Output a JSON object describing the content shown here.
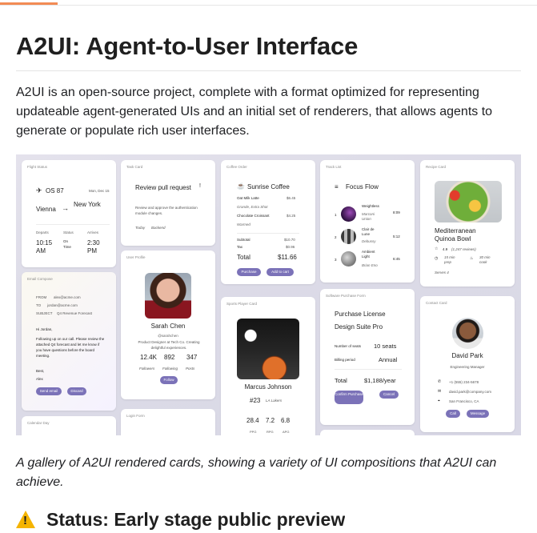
{
  "page": {
    "title": "A2UI: Agent-to-User Interface",
    "intro": "A2UI is an open-source project, complete with a format optimized for representing updateable agent-generated UIs and an initial set of renderers, that allows agents to generate or populate rich user interfaces.",
    "caption": "A gallery of A2UI rendered cards, showing a variety of UI compositions that A2UI can achieve.",
    "status_heading": "Status: Early stage public preview",
    "colors": {
      "accent": "#f28b54",
      "button": "#7b72b8",
      "warning": "#f5b400"
    }
  },
  "gallery": {
    "flight": {
      "title": "Flight Status",
      "flight_no": "OS 87",
      "date": "Mon, Dec 15",
      "from": "Vienna",
      "arrow": "→",
      "to": "New York",
      "departs_label": "Departs",
      "status_label": "Status",
      "arrives_label": "Arrives",
      "departs": "10:15 AM",
      "status": "On Time",
      "arrives": "2:30 PM"
    },
    "email": {
      "title": "Email Compose",
      "from_label": "FROM",
      "from": "alex@acme.com",
      "to_label": "TO",
      "to": "jordan@acme.com",
      "subject_label": "SUBJECT",
      "subject": "Q4 Revenue Forecast",
      "greeting": "Hi Jordan,",
      "body": "Following up on our call. Please review the attached Q4 forecast and let me know if you have questions before the board meeting.",
      "signoff": "Best,",
      "signer": "Alex",
      "send": "Send email",
      "discard": "Discard"
    },
    "calendar": {
      "title": "Calendar Day"
    },
    "task": {
      "title": "Task Card",
      "heading": "Review pull request",
      "mark": "!",
      "desc": "Review and approve the authentication module changes.",
      "due": "Today",
      "tag": "Backend"
    },
    "profile": {
      "title": "User Profile",
      "name": "Sarah Chen",
      "handle": "@sarahchen",
      "bio": "Product Designer at Tech Co. Creating delightful experiences.",
      "stats": [
        {
          "value": "12.4K",
          "label": "Followers"
        },
        {
          "value": "892",
          "label": "Following"
        },
        {
          "value": "347",
          "label": "Posts"
        }
      ],
      "follow": "Follow"
    },
    "login": {
      "title": "Login Form"
    },
    "coffee": {
      "title": "Coffee Order",
      "shop": "Sunrise Coffee",
      "items": [
        {
          "name": "Oat Milk Latte",
          "price": "$6.45",
          "note": "Grande, Extra Shot"
        },
        {
          "name": "Chocolate Croissant",
          "price": "$4.25",
          "note": "Warmed"
        }
      ],
      "subtotal_label": "Subtotal",
      "subtotal": "$10.70",
      "tax_label": "Tax",
      "tax": "$0.96",
      "total_label": "Total",
      "total": "$11.66",
      "purchase": "Purchase",
      "add": "Add to cart"
    },
    "player": {
      "title": "Sports Player Card",
      "name": "Marcus Johnson",
      "number": "#23",
      "team": "LA Lakers",
      "stats": [
        {
          "value": "28.4",
          "label": "PPG"
        },
        {
          "value": "7.2",
          "label": "RPG"
        },
        {
          "value": "6.8",
          "label": "APG"
        }
      ]
    },
    "tracks": {
      "title": "Track List",
      "playlist": "Focus Flow",
      "items": [
        {
          "n": "1",
          "song": "Weightless",
          "artist": "Marconi Union",
          "time": "8:09"
        },
        {
          "n": "2",
          "song": "Clair de Lune",
          "artist": "Debussy",
          "time": "5:12"
        },
        {
          "n": "3",
          "song": "Ambient Light",
          "artist": "Brian Eno",
          "time": "6:45"
        }
      ]
    },
    "purchase": {
      "title": "Software Purchase Form",
      "heading1": "Purchase License",
      "heading2": "Design Suite Pro",
      "seats_label": "Number of seats",
      "seats": "10 seats",
      "billing_label": "Billing period",
      "billing": "Annual",
      "total_label": "Total",
      "total": "$1,188/year",
      "confirm": "Confirm Purchase",
      "cancel": "Cancel"
    },
    "recipe": {
      "title": "Recipe Card",
      "name1": "Mediterranean",
      "name2": "Quinoa Bowl",
      "rating": "4.9",
      "reviews": "(1,247 reviews)",
      "prep": "15 min prep",
      "cook": "30 min cook",
      "serves": "Serves 4"
    },
    "contact": {
      "title": "Contact Card",
      "name": "David Park",
      "role": "Engineering Manager",
      "phone": "+1 (555) 234-5678",
      "email": "david.park@company.com",
      "location": "San Francisco, CA",
      "call": "Call",
      "message": "Message"
    }
  }
}
